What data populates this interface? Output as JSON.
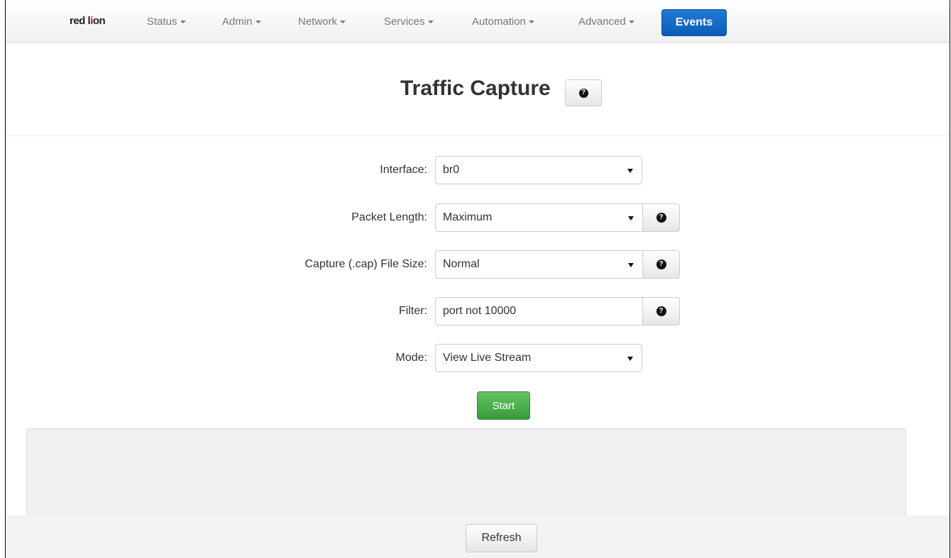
{
  "app": {
    "logo_text_a": "red l",
    "logo_text_b": "i",
    "logo_text_c": "on",
    "brand_color": "#c8102e"
  },
  "nav": {
    "items": [
      {
        "label": "Status"
      },
      {
        "label": "Admin"
      },
      {
        "label": "Network"
      },
      {
        "label": "Services"
      },
      {
        "label": "Automation"
      },
      {
        "label": "Advanced"
      }
    ],
    "active_label": "Events",
    "active_color": "#1a6fc9"
  },
  "page": {
    "title": "Traffic Capture",
    "help_icon": "question-circle-icon"
  },
  "form": {
    "interface": {
      "label": "Interface:",
      "value": "br0"
    },
    "packet_length": {
      "label": "Packet Length:",
      "value": "Maximum"
    },
    "file_size": {
      "label": "Capture (.cap) File Size:",
      "value": "Normal"
    },
    "filter": {
      "label": "Filter:",
      "value": "port not 10000"
    },
    "mode": {
      "label": "Mode:",
      "value": "View Live Stream"
    },
    "start_label": "Start",
    "start_color": "#4cae4c"
  },
  "footer": {
    "refresh_label": "Refresh"
  }
}
